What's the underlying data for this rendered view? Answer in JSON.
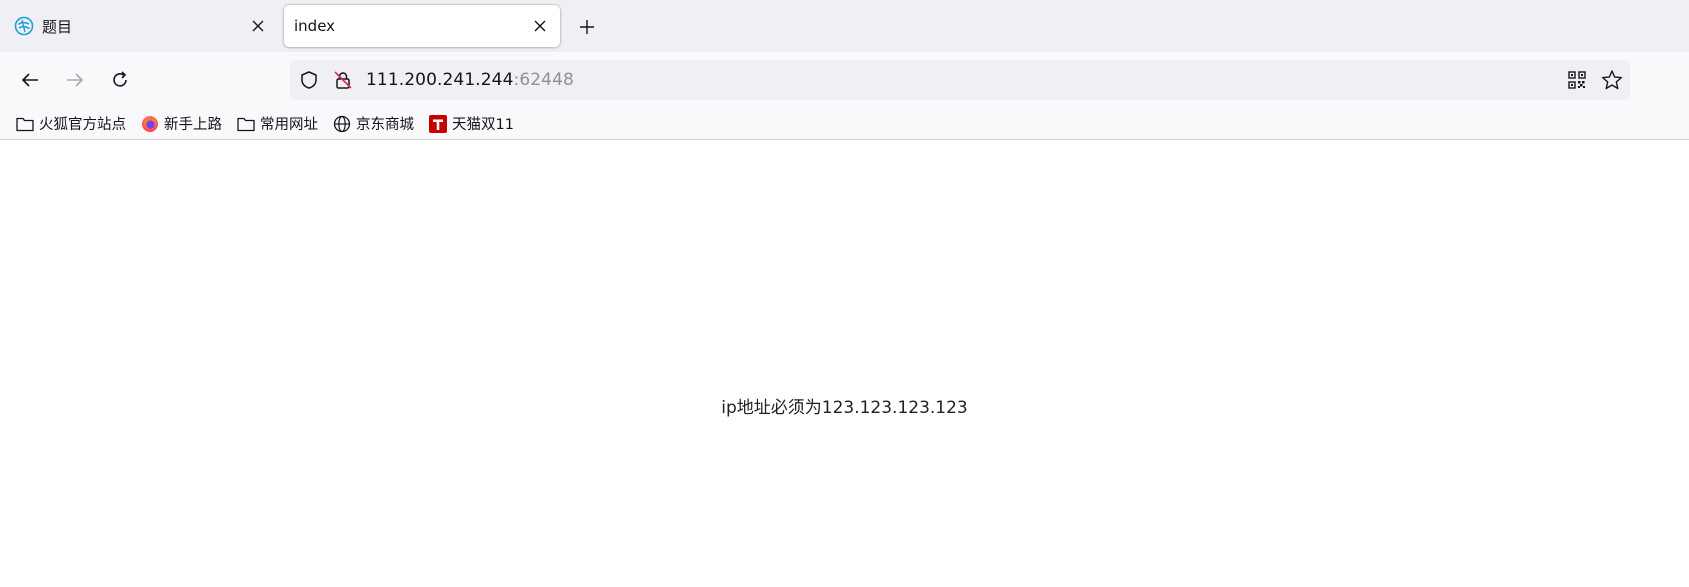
{
  "tabs": [
    {
      "title": "题目",
      "active": false
    },
    {
      "title": "index",
      "active": true
    }
  ],
  "address_bar": {
    "host": "111.200.241.244",
    "port": ":62448"
  },
  "bookmarks": [
    {
      "label": "火狐官方站点",
      "icon": "folder-icon"
    },
    {
      "label": "新手上路",
      "icon": "firefox-icon"
    },
    {
      "label": "常用网址",
      "icon": "folder-icon"
    },
    {
      "label": "京东商城",
      "icon": "globe-icon"
    },
    {
      "label": "天猫双11",
      "icon": "tmall-icon"
    }
  ],
  "page": {
    "message": "ip地址必须为123.123.123.123"
  },
  "colors": {
    "tabstrip_bg": "#f0f0f4",
    "toolbar_bg": "#f9f9fb",
    "tmall_red": "#c40000",
    "firefox_orange": "#ff7139"
  }
}
